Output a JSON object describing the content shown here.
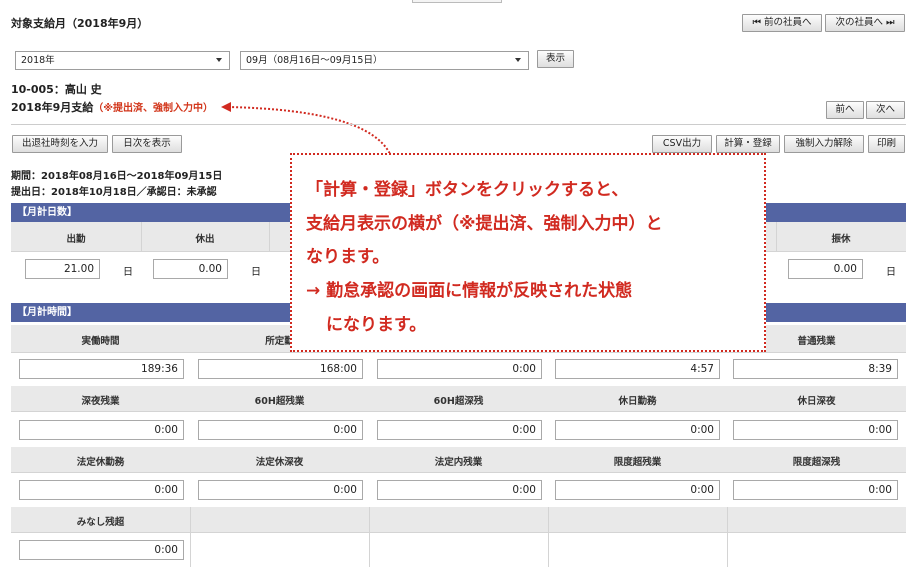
{
  "page": {
    "title": "対象支給月（2018年9月）"
  },
  "nav": {
    "prev_employee": "⏮ 前の社員へ",
    "next_employee": "次の社員へ ⏭",
    "prev": "前へ",
    "next": "次へ"
  },
  "filters": {
    "year": "2018年",
    "month": "09月（08月16日〜09月15日）",
    "show": "表示"
  },
  "employee": {
    "id_name": "10-005：高山 史",
    "pay_month": "2018年9月支給",
    "status": "（※提出済、強制入力中）"
  },
  "toolbar": {
    "input_clock": "出退社時刻を入力",
    "show_daily": "日次を表示",
    "csv": "CSV出力",
    "calc_register": "計算・登録",
    "force_release": "強制入力解除",
    "print": "印刷"
  },
  "period": {
    "line1": "期間：2018年08月16日〜2018年09月15日",
    "line2": "提出日：2018年10月18日／承認日：未承認"
  },
  "monthly_days": {
    "header": "【月計日数】",
    "cols": [
      {
        "label": "出勤",
        "value": "21.00",
        "unit": "日"
      },
      {
        "label": "休出",
        "value": "0.00",
        "unit": "日"
      },
      {
        "label": "振休",
        "value": "0.00",
        "unit": "日"
      }
    ]
  },
  "monthly_hours": {
    "header": "【月計時間】",
    "row1": [
      {
        "label": "実働時間",
        "value": "189:36"
      },
      {
        "label": "所定勤",
        "value": "168:00"
      },
      {
        "label": "",
        "value": "0:00"
      },
      {
        "label": "",
        "value": "4:57"
      },
      {
        "label": "普通残業",
        "value": "8:39"
      }
    ],
    "row2": [
      {
        "label": "深夜残業",
        "value": "0:00"
      },
      {
        "label": "60H超残業",
        "value": "0:00"
      },
      {
        "label": "60H超深残",
        "value": "0:00"
      },
      {
        "label": "休日勤務",
        "value": "0:00"
      },
      {
        "label": "休日深夜",
        "value": "0:00"
      }
    ],
    "row3": [
      {
        "label": "法定休勤務",
        "value": "0:00"
      },
      {
        "label": "法定休深夜",
        "value": "0:00"
      },
      {
        "label": "法定内残業",
        "value": "0:00"
      },
      {
        "label": "限度超残業",
        "value": "0:00"
      },
      {
        "label": "限度超深残",
        "value": "0:00"
      }
    ],
    "row4": [
      {
        "label": "みなし残超",
        "value": "0:00"
      }
    ]
  },
  "callout": {
    "line1": "「計算・登録」ボタンをクリックすると、",
    "line2": "支給月表示の横が（※提出済、強制入力中）と",
    "line3": "なります。",
    "line4": "→ 勤怠承認の画面に情報が反映された状態",
    "line5": "になります。"
  },
  "colors": {
    "header_bar": "#5364a3",
    "status_red": "#d2361b",
    "callout_red": "#d12a20"
  }
}
